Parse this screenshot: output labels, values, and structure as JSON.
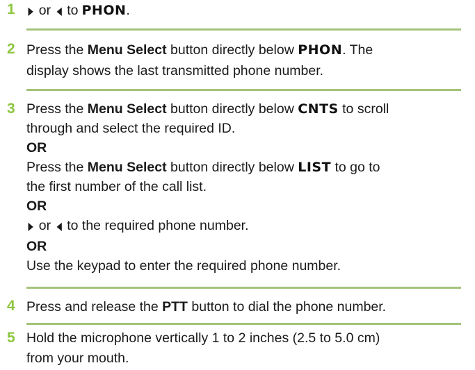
{
  "accent_color": "#8dc63f",
  "rule_color": "#a4c37a",
  "steps": [
    {
      "number": "1",
      "arrow_right": "▶",
      "or_word": "or",
      "arrow_left": "◀",
      "to_word": "to",
      "display_key": "PHON",
      "end": "."
    },
    {
      "number": "2",
      "pre": "Press the",
      "button": "Menu Select",
      "mid": "button directly below",
      "display_key": "PHON",
      "post": ". The",
      "line2": "display shows the last transmitted phone number."
    },
    {
      "number": "3",
      "a_pre": "Press the",
      "a_button": "Menu Select",
      "a_mid": "button directly below",
      "a_key": "CNTS",
      "a_post": "to scroll",
      "a_line2": "through and select the required ID.",
      "or1": "OR",
      "b_pre": "Press the",
      "b_button": "Menu Select",
      "b_mid": "button directly below",
      "b_key": "LIST",
      "b_post": "to go to",
      "b_line2": "the first number of the call list.",
      "or2": "OR",
      "c_arrow_right": "▶",
      "c_or": "or",
      "c_arrow_left": "◀",
      "c_text": "to the required phone number.",
      "or3": "OR",
      "d_text": "Use the keypad to enter the required phone number."
    },
    {
      "number": "4",
      "pre": "Press and release the",
      "button": "PTT",
      "post": "button to dial the phone number."
    },
    {
      "number": "5",
      "line1": "Hold the microphone vertically 1 to 2 inches (2.5 to 5.0 cm)",
      "line2": "from your mouth."
    }
  ]
}
